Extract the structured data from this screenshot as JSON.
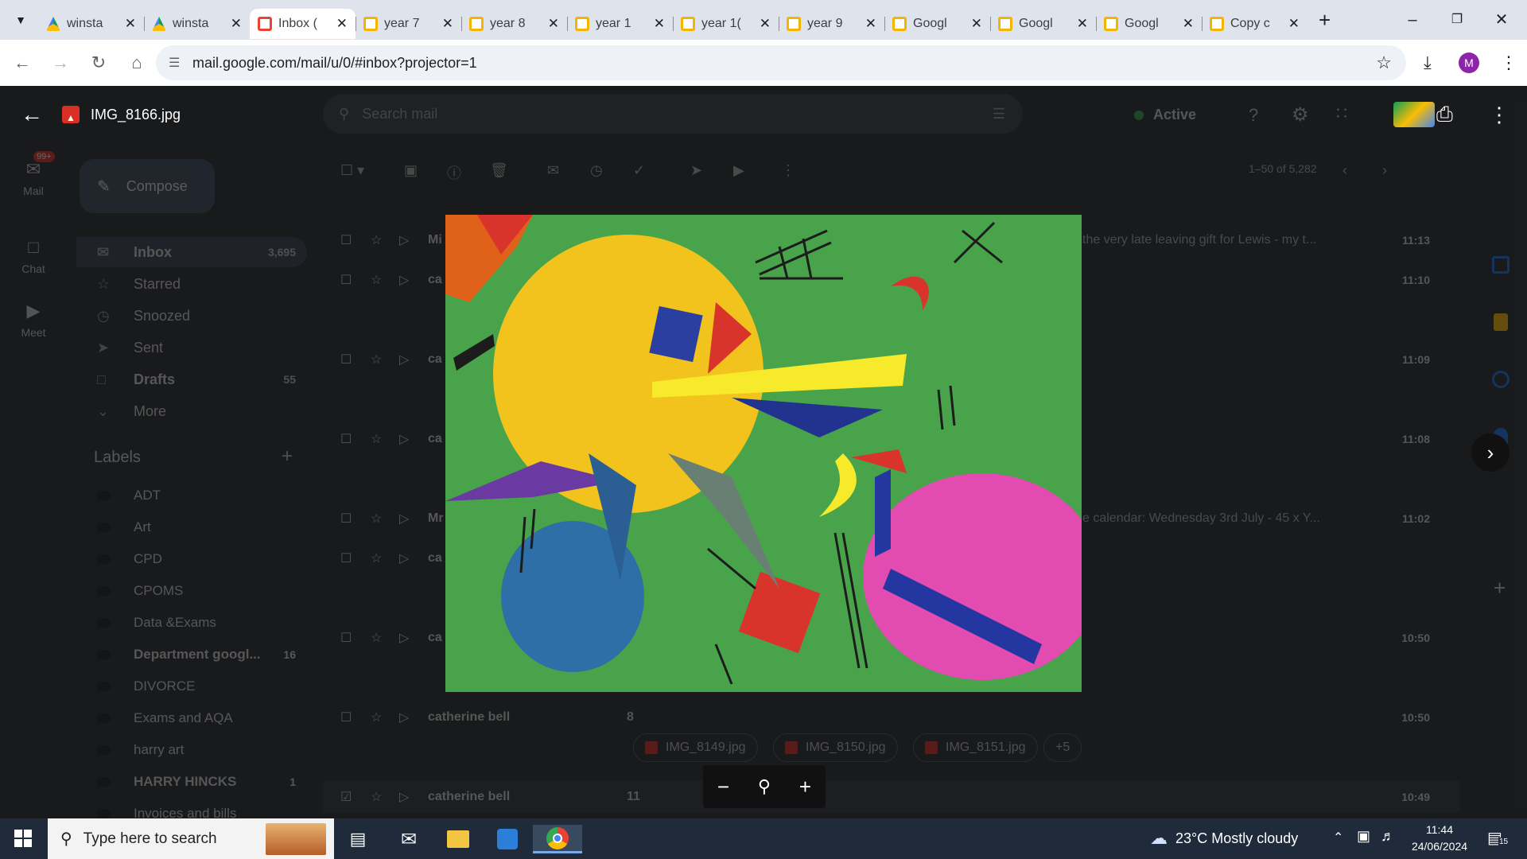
{
  "browser": {
    "tabs": [
      {
        "title": "winsta",
        "icon": "drive-icon",
        "active": false
      },
      {
        "title": "winsta",
        "icon": "drive-icon",
        "active": false
      },
      {
        "title": "Inbox (",
        "icon": "gmail-icon",
        "active": true
      },
      {
        "title": "year 7",
        "icon": "slides-icon",
        "active": false
      },
      {
        "title": "year 8",
        "icon": "slides-icon",
        "active": false
      },
      {
        "title": "year 1",
        "icon": "slides-icon",
        "active": false
      },
      {
        "title": "year 1(",
        "icon": "slides-icon",
        "active": false
      },
      {
        "title": "year 9",
        "icon": "slides-icon",
        "active": false
      },
      {
        "title": "Googl",
        "icon": "slides-icon",
        "active": false
      },
      {
        "title": "Googl",
        "icon": "slides-icon",
        "active": false
      },
      {
        "title": "Googl",
        "icon": "slides-icon",
        "active": false
      },
      {
        "title": "Copy c",
        "icon": "slides-icon",
        "active": false
      }
    ],
    "url": "mail.google.com/mail/u/0/#inbox?projector=1",
    "profile_initial": "M"
  },
  "viewer": {
    "filename": "IMG_8166.jpg"
  },
  "gmail": {
    "search_placeholder": "Search mail",
    "status": "Active",
    "compose_label": "Compose",
    "mail_badge": "99+",
    "rail": {
      "mail": "Mail",
      "chat": "Chat",
      "meet": "Meet"
    },
    "pagination": "1–50 of 5,282",
    "nav": [
      {
        "label": "Inbox",
        "count": "3,695"
      },
      {
        "label": "Starred",
        "count": ""
      },
      {
        "label": "Snoozed",
        "count": ""
      },
      {
        "label": "Sent",
        "count": ""
      },
      {
        "label": "Drafts",
        "count": "55"
      },
      {
        "label": "More",
        "count": ""
      }
    ],
    "labels_title": "Labels",
    "labels": [
      {
        "name": "ADT",
        "count": ""
      },
      {
        "name": "Art",
        "count": ""
      },
      {
        "name": "CPD",
        "count": ""
      },
      {
        "name": "CPOMS",
        "count": ""
      },
      {
        "name": "Data &Exams",
        "count": ""
      },
      {
        "name": "Department googl...",
        "count": "16"
      },
      {
        "name": "DIVORCE",
        "count": ""
      },
      {
        "name": "Exams and AQA",
        "count": ""
      },
      {
        "name": "harry art",
        "count": ""
      },
      {
        "name": "HARRY HINCKS",
        "count": "1"
      },
      {
        "name": "Invoices and bills",
        "count": ""
      }
    ],
    "rows": [
      {
        "sender": "Mi",
        "count": "",
        "snippet": "the very late leaving gift for Lewis - my t...",
        "time": "11:13"
      },
      {
        "sender": "ca",
        "count": "",
        "snippet": "",
        "time": "11:10"
      },
      {
        "sender": "ca",
        "count": "",
        "snippet": "",
        "time": "11:09"
      },
      {
        "sender": "ca",
        "count": "",
        "snippet": "",
        "time": "11:08"
      },
      {
        "sender": "Mr",
        "count": "",
        "snippet": "e calendar: Wednesday 3rd July - 45 x Y...",
        "time": "11:02"
      },
      {
        "sender": "ca",
        "count": "",
        "snippet": "",
        "time": ""
      },
      {
        "sender": "ca",
        "count": "",
        "snippet": "",
        "time": "10:50"
      },
      {
        "sender": "catherine bell",
        "count": "8",
        "snippet": "",
        "time": "10:50"
      },
      {
        "sender": "catherine bell",
        "count": "11",
        "snippet": "",
        "time": "10:49"
      }
    ],
    "attachments": [
      "IMG_8149.jpg",
      "IMG_8150.jpg",
      "IMG_8151.jpg",
      "+5"
    ]
  },
  "taskbar": {
    "search_placeholder": "Type here to search",
    "weather": "23°C  Mostly cloudy",
    "time": "11:44",
    "date": "24/06/2024",
    "notifications": "15"
  },
  "colors": {
    "gmail_red": "#d93025",
    "painting_green": "#3c9b44",
    "painting_yellow": "#f2c31c",
    "painting_pink": "#e24bb0",
    "painting_blue": "#2f6fa8"
  }
}
